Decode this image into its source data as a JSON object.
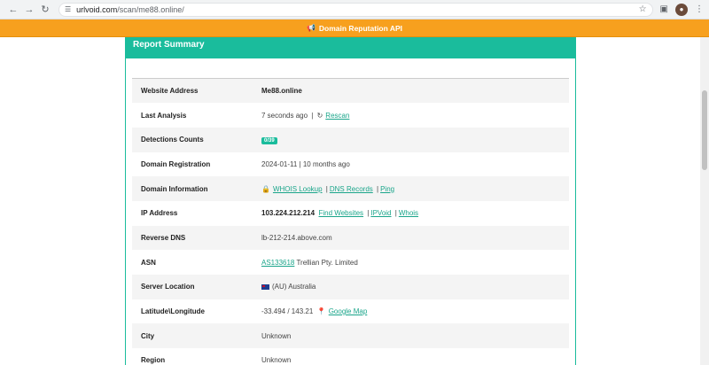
{
  "browser": {
    "url_host": "urlvoid.com",
    "url_path": "/scan/me88.online/"
  },
  "banner": {
    "text": "Domain Reputation API"
  },
  "report": {
    "title": "Report Summary",
    "rows": {
      "website_address": {
        "label": "Website Address",
        "value": "Me88.online"
      },
      "last_analysis": {
        "label": "Last Analysis",
        "value": "7 seconds ago",
        "sep": "|",
        "rescan": "Rescan"
      },
      "detections": {
        "label": "Detections Counts",
        "badge": "0/39"
      },
      "domain_registration": {
        "label": "Domain Registration",
        "value": "2024-01-11 | 10 months ago"
      },
      "domain_information": {
        "label": "Domain Information",
        "whois": "WHOIS Lookup",
        "dns": "DNS Records",
        "ping": "Ping",
        "sep": "|"
      },
      "ip_address": {
        "label": "IP Address",
        "value": "103.224.212.214",
        "find_websites": "Find Websites",
        "ipvoid": "IPVoid",
        "whois": "Whois",
        "sep": "|"
      },
      "reverse_dns": {
        "label": "Reverse DNS",
        "value": "lb-212-214.above.com"
      },
      "asn": {
        "label": "ASN",
        "asn_link": "AS133618",
        "value": "Trellian Pty. Limited"
      },
      "server_location": {
        "label": "Server Location",
        "value": "(AU) Australia"
      },
      "lat_long": {
        "label": "Latitude\\Longitude",
        "value": "-33.494 / 143.21",
        "map": "Google Map"
      },
      "city": {
        "label": "City",
        "value": "Unknown"
      },
      "region": {
        "label": "Region",
        "value": "Unknown"
      }
    }
  },
  "icons": {
    "back": "arrow-left",
    "forward": "arrow-right",
    "reload": "reload",
    "site_info": "tune",
    "star": "star",
    "extensions": "puzzle",
    "menu": "kebab",
    "megaphone": "megaphone",
    "refresh": "refresh",
    "lock": "lock",
    "map_pin": "map-marker"
  },
  "colors": {
    "accent": "#1abc9c",
    "banner": "#f7a01e",
    "link": "#1aa58a"
  }
}
